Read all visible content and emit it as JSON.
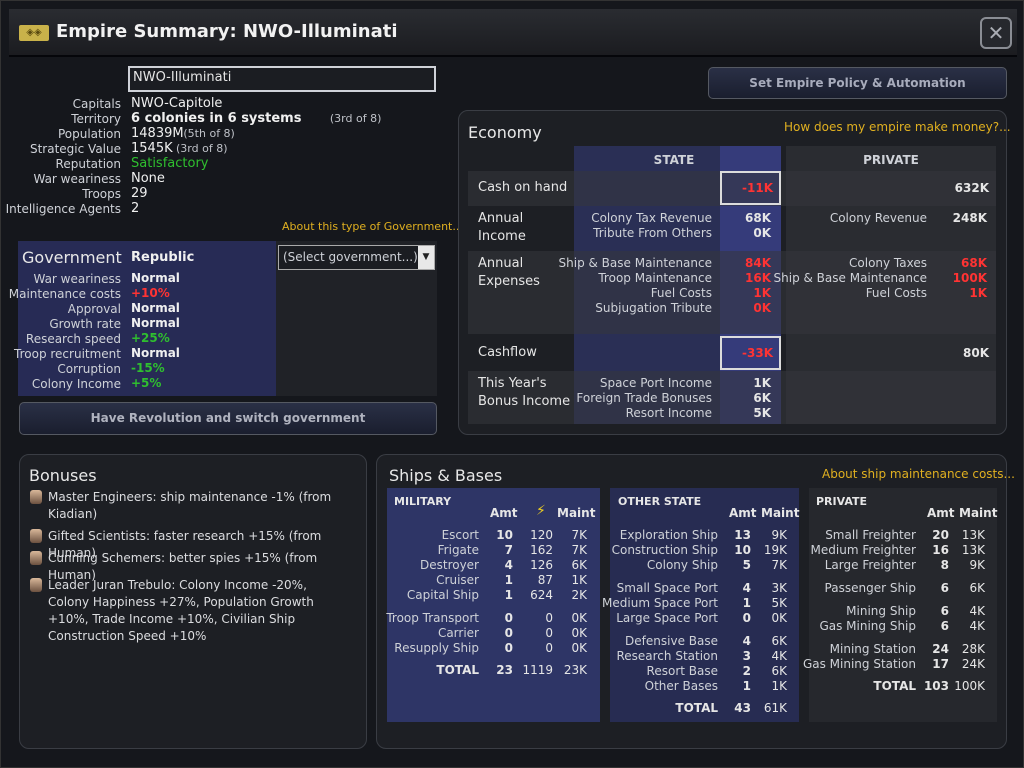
{
  "window": {
    "title": "Empire Summary: NWO-Illuminati"
  },
  "empire": {
    "name": "NWO-Illuminati",
    "policy_button": "Set Empire Policy & Automation",
    "rows": [
      {
        "label": "Capitals",
        "value": "NWO-Capitole",
        "extra": ""
      },
      {
        "label": "Territory",
        "value": "6 colonies in 6 systems",
        "extra": "(3rd of 8)"
      },
      {
        "label": "Population",
        "value": "14839M",
        "extra": "(5th of 8)"
      },
      {
        "label": "Strategic Value",
        "value": "1545K",
        "extra": "(3rd of 8)"
      },
      {
        "label": "Reputation",
        "value": "Satisfactory",
        "extra": ""
      },
      {
        "label": "War weariness",
        "value": "None",
        "extra": ""
      },
      {
        "label": "Troops",
        "value": "29",
        "extra": ""
      },
      {
        "label": "Intelligence Agents",
        "value": "2",
        "extra": ""
      }
    ]
  },
  "government": {
    "about_link": "About this type of Government...",
    "title": "Government",
    "type": "Republic",
    "select_placeholder": "(Select government...)",
    "rows": [
      {
        "label": "War weariness",
        "value": "Normal"
      },
      {
        "label": "Maintenance costs",
        "value": "+10%"
      },
      {
        "label": "Approval",
        "value": "Normal"
      },
      {
        "label": "Growth rate",
        "value": "Normal"
      },
      {
        "label": "Research speed",
        "value": "+25%"
      },
      {
        "label": "Troop recruitment",
        "value": "Normal"
      },
      {
        "label": "Corruption",
        "value": "-15%"
      },
      {
        "label": "Colony Income",
        "value": "+5%"
      }
    ],
    "revolution_button": "Have Revolution and switch government"
  },
  "economy": {
    "title": "Economy",
    "link": "How does my empire make money?...",
    "state_header": "STATE",
    "private_header": "PRIVATE",
    "cash_label": "Cash on hand",
    "cash_state": "-11K",
    "cash_private": "632K",
    "income_label": "Annual Income",
    "income_state": [
      {
        "label": "Colony Tax Revenue",
        "value": "68K"
      },
      {
        "label": "Tribute From Others",
        "value": "0K"
      }
    ],
    "income_private": [
      {
        "label": "Colony Revenue",
        "value": "248K"
      }
    ],
    "expenses_label": "Annual Expenses",
    "expenses_state": [
      {
        "label": "Ship & Base Maintenance",
        "value": "84K"
      },
      {
        "label": "Troop Maintenance",
        "value": "16K"
      },
      {
        "label": "Fuel Costs",
        "value": "1K"
      },
      {
        "label": "Subjugation Tribute",
        "value": "0K"
      }
    ],
    "expenses_private": [
      {
        "label": "Colony Taxes",
        "value": "68K"
      },
      {
        "label": "Ship & Base Maintenance",
        "value": "100K"
      },
      {
        "label": "Fuel Costs",
        "value": "1K"
      }
    ],
    "cashflow_label": "Cashflow",
    "cashflow_state": "-33K",
    "cashflow_private": "80K",
    "bonus_label": "This Year's Bonus Income",
    "bonus_state": [
      {
        "label": "Space Port Income",
        "value": "1K"
      },
      {
        "label": "Foreign Trade Bonuses",
        "value": "6K"
      },
      {
        "label": "Resort Income",
        "value": "5K"
      }
    ]
  },
  "bonuses": {
    "title": "Bonuses",
    "items": [
      {
        "text": "Master Engineers: ship maintenance -1% (from Kiadian)"
      },
      {
        "text": "Gifted Scientists: faster research +15% (from Human)"
      },
      {
        "text": "Cunning Schemers: better spies +15% (from Human)"
      },
      {
        "text": "Leader Juran Trebulo: Colony Income -20%, Colony Happiness +27%, Population Growth +10%, Trade Income +10%, Civilian Ship Construction Speed +10%"
      }
    ]
  },
  "ships": {
    "title": "Ships & Bases",
    "link": "About ship maintenance costs...",
    "amt_header": "Amt",
    "maint_header": "Maint",
    "total_label": "TOTAL",
    "military": {
      "title": "MILITARY",
      "rows": [
        {
          "name": "Escort",
          "amt": "10",
          "power": "120",
          "maint": "7K"
        },
        {
          "name": "Frigate",
          "amt": "7",
          "power": "162",
          "maint": "7K"
        },
        {
          "name": "Destroyer",
          "amt": "4",
          "power": "126",
          "maint": "6K"
        },
        {
          "name": "Cruiser",
          "amt": "1",
          "power": "87",
          "maint": "1K"
        },
        {
          "name": "Capital Ship",
          "amt": "1",
          "power": "624",
          "maint": "2K"
        },
        {
          "name": "Troop Transport",
          "amt": "0",
          "power": "0",
          "maint": "0K"
        },
        {
          "name": "Carrier",
          "amt": "0",
          "power": "0",
          "maint": "0K"
        },
        {
          "name": "Resupply Ship",
          "amt": "0",
          "power": "0",
          "maint": "0K"
        }
      ],
      "total_amt": "23",
      "total_power": "1119",
      "total_maint": "23K"
    },
    "other": {
      "title": "OTHER STATE",
      "rows": [
        {
          "name": "Exploration Ship",
          "amt": "13",
          "maint": "9K"
        },
        {
          "name": "Construction Ship",
          "amt": "10",
          "maint": "19K"
        },
        {
          "name": "Colony Ship",
          "amt": "5",
          "maint": "7K"
        },
        {
          "name": "Small Space Port",
          "amt": "4",
          "maint": "3K"
        },
        {
          "name": "Medium Space Port",
          "amt": "1",
          "maint": "5K"
        },
        {
          "name": "Large Space Port",
          "amt": "0",
          "maint": "0K"
        },
        {
          "name": "Defensive Base",
          "amt": "4",
          "maint": "6K"
        },
        {
          "name": "Research Station",
          "amt": "3",
          "maint": "4K"
        },
        {
          "name": "Resort Base",
          "amt": "2",
          "maint": "6K"
        },
        {
          "name": "Other Bases",
          "amt": "1",
          "maint": "1K"
        }
      ],
      "total_amt": "43",
      "total_maint": "61K"
    },
    "private": {
      "title": "PRIVATE",
      "rows": [
        {
          "name": "Small Freighter",
          "amt": "20",
          "maint": "13K"
        },
        {
          "name": "Medium Freighter",
          "amt": "16",
          "maint": "13K"
        },
        {
          "name": "Large Freighter",
          "amt": "8",
          "maint": "9K"
        },
        {
          "name": "Passenger Ship",
          "amt": "6",
          "maint": "6K"
        },
        {
          "name": "Mining Ship",
          "amt": "6",
          "maint": "4K"
        },
        {
          "name": "Gas Mining Ship",
          "amt": "6",
          "maint": "4K"
        },
        {
          "name": "Mining Station",
          "amt": "24",
          "maint": "28K"
        },
        {
          "name": "Gas Mining Station",
          "amt": "17",
          "maint": "24K"
        }
      ],
      "total_amt": "103",
      "total_maint": "100K"
    }
  },
  "colors": {
    "accent": "#e0b020",
    "green": "#2fbf2f",
    "red": "#ff3333",
    "military_bg": "#2e3566"
  }
}
